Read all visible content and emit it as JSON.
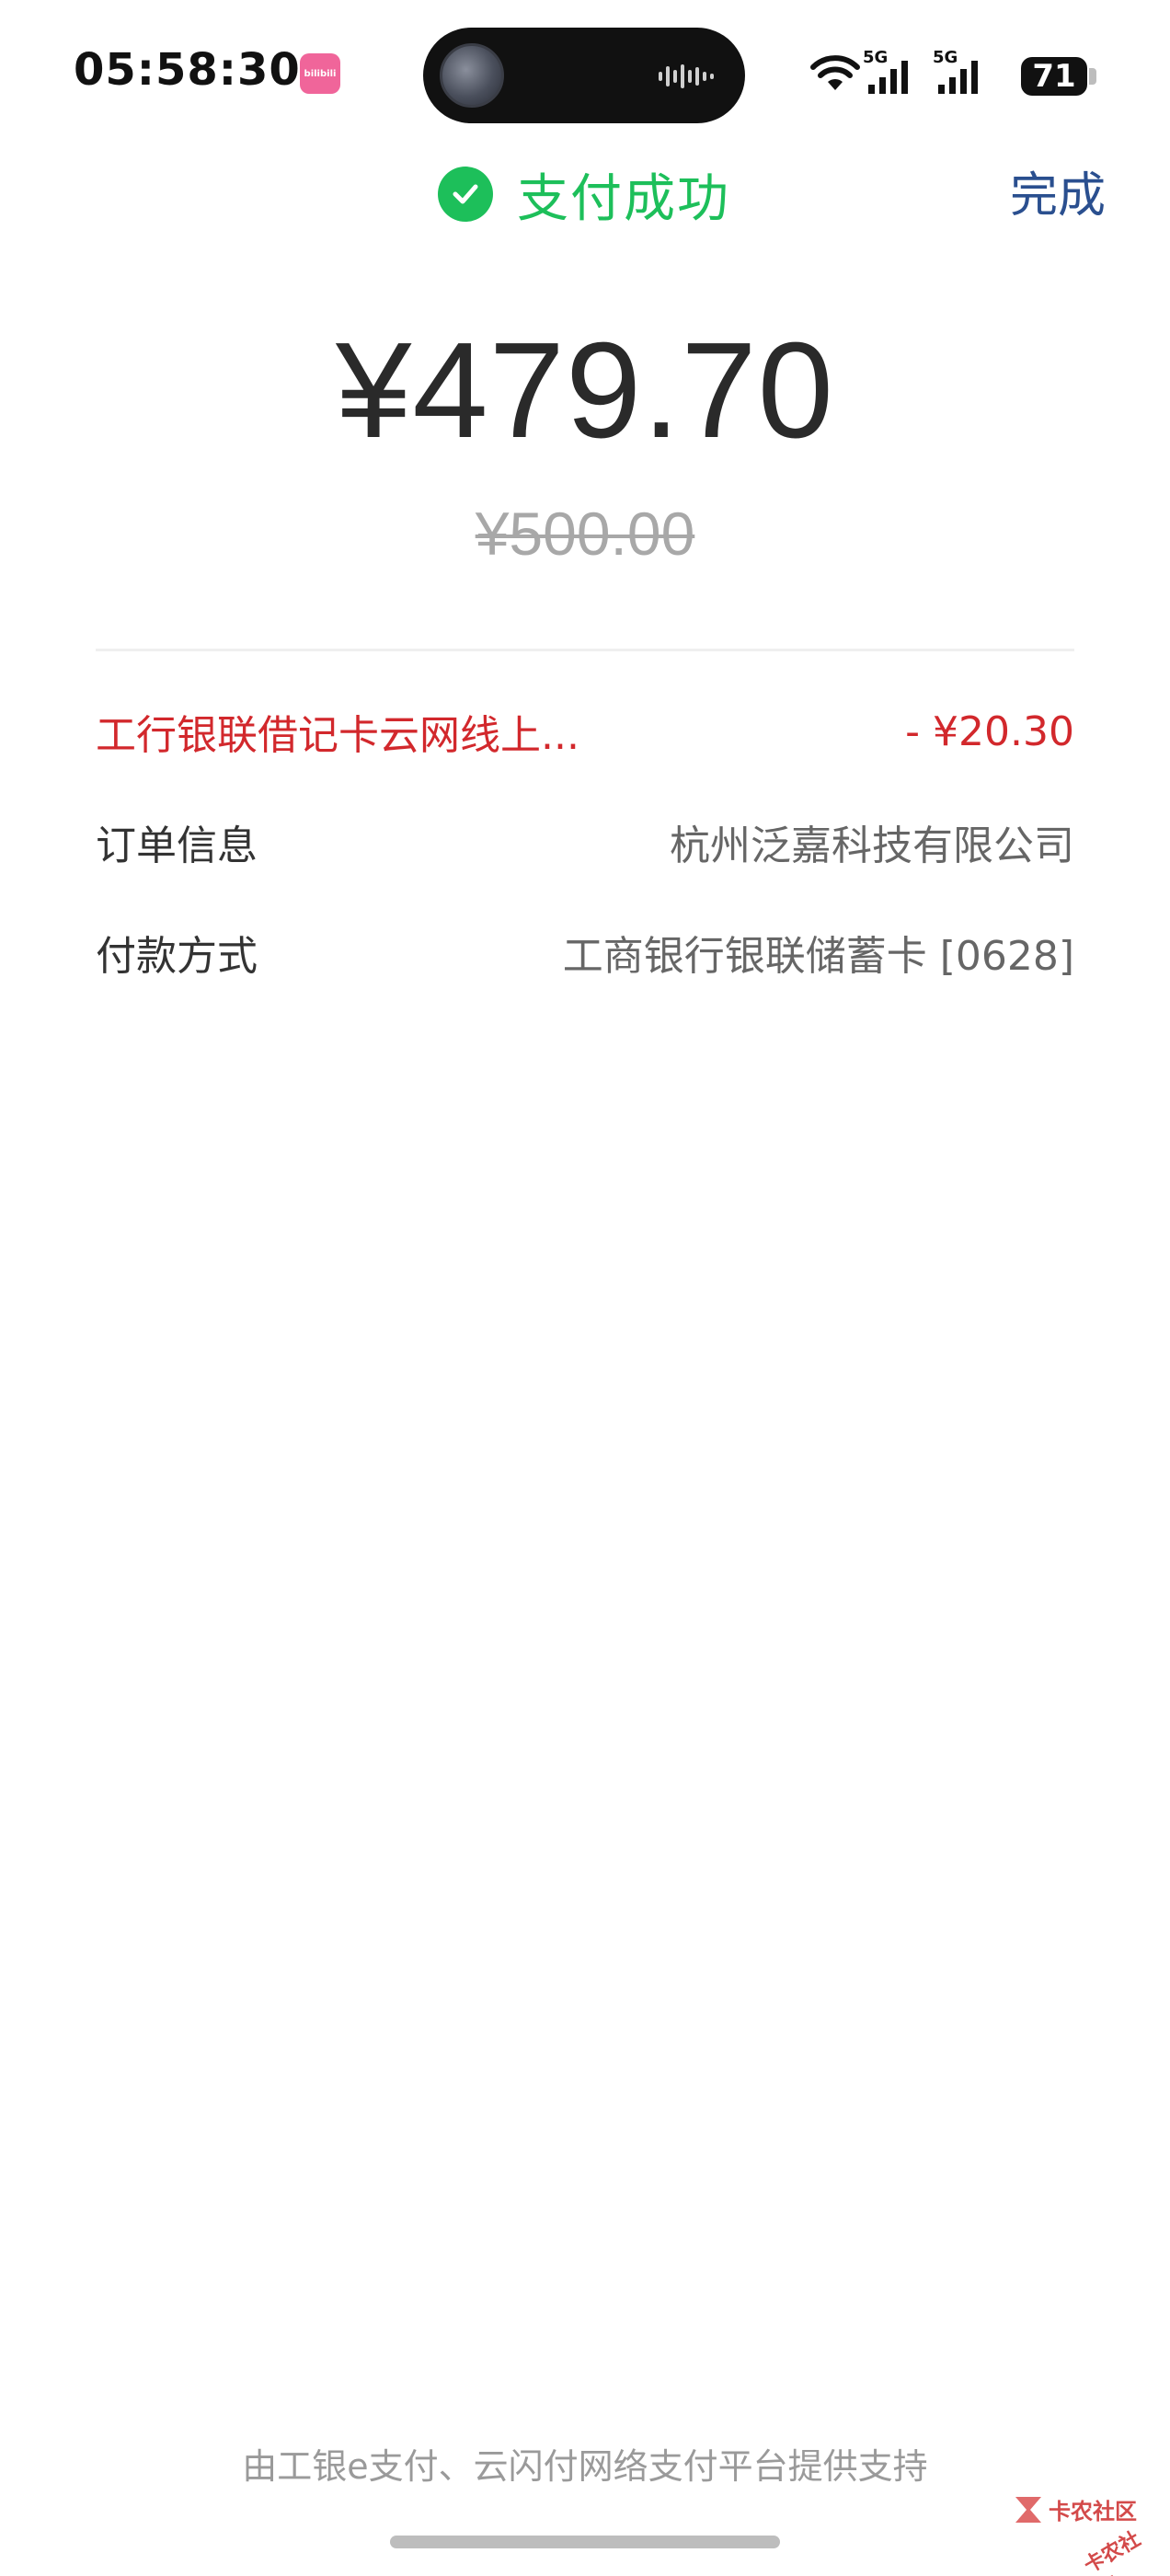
{
  "status_bar": {
    "time": "05:58:30",
    "app_badge_label": "bilibili",
    "battery_level": "71",
    "network_labels": [
      "5G",
      "5G"
    ]
  },
  "header": {
    "title": "支付成功",
    "done_label": "完成",
    "success_color": "#1dbf5a"
  },
  "payment": {
    "amount": "¥479.70",
    "original_amount": "¥500.00"
  },
  "details": {
    "discount_label": "工行银联借记卡云网线上...",
    "discount_value": "- ¥20.30",
    "order_label": "订单信息",
    "order_value": "杭州泛嘉科技有限公司",
    "payment_method_label": "付款方式",
    "payment_method_value": "工商银行银联储蓄卡 [0628]"
  },
  "footer": {
    "text": "由工银e支付、云闪付网络支付平台提供支持"
  },
  "watermark": {
    "text": "卡农社区",
    "text2": "卡农社区"
  },
  "colors": {
    "accent_green": "#1dbf5a",
    "discount_red": "#d2282c",
    "link_blue": "#2a4f8f"
  }
}
